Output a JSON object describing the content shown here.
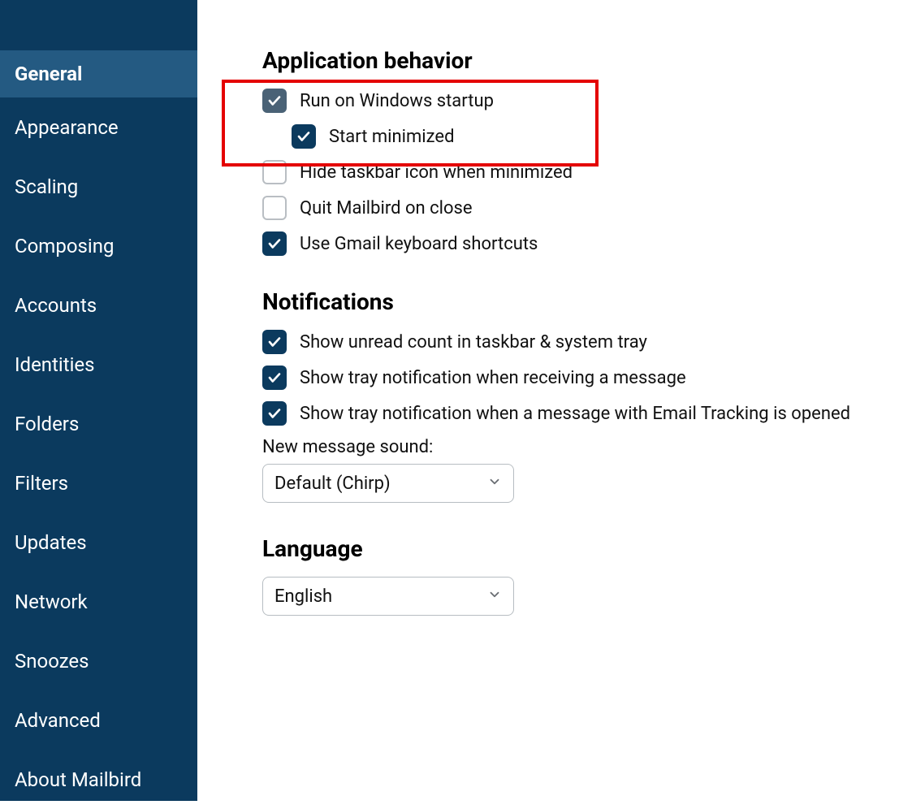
{
  "sidebar": {
    "items": [
      {
        "label": "General",
        "active": true
      },
      {
        "label": "Appearance",
        "active": false
      },
      {
        "label": "Scaling",
        "active": false
      },
      {
        "label": "Composing",
        "active": false
      },
      {
        "label": "Accounts",
        "active": false
      },
      {
        "label": "Identities",
        "active": false
      },
      {
        "label": "Folders",
        "active": false
      },
      {
        "label": "Filters",
        "active": false
      },
      {
        "label": "Updates",
        "active": false
      },
      {
        "label": "Network",
        "active": false
      },
      {
        "label": "Snoozes",
        "active": false
      },
      {
        "label": "Advanced",
        "active": false
      },
      {
        "label": "About Mailbird",
        "active": false
      }
    ]
  },
  "sections": {
    "app_behavior": {
      "title": "Application behavior",
      "options": {
        "run_on_startup": {
          "label": "Run on Windows startup",
          "checked": true,
          "style": "gray"
        },
        "start_minimized": {
          "label": "Start minimized",
          "checked": true,
          "style": "navy",
          "nested": true
        },
        "hide_taskbar": {
          "label": "Hide taskbar icon when minimized",
          "checked": false
        },
        "quit_on_close": {
          "label": "Quit Mailbird on close",
          "checked": false
        },
        "gmail_shortcuts": {
          "label": "Use Gmail keyboard shortcuts",
          "checked": true,
          "style": "navy"
        }
      }
    },
    "notifications": {
      "title": "Notifications",
      "options": {
        "unread_count": {
          "label": "Show unread count in taskbar & system tray",
          "checked": true,
          "style": "navy"
        },
        "tray_receive": {
          "label": "Show tray notification when receiving a message",
          "checked": true,
          "style": "navy"
        },
        "tray_tracking": {
          "label": "Show tray notification when a message with Email Tracking is opened",
          "checked": true,
          "style": "navy"
        }
      },
      "sound_label": "New message sound:",
      "sound_value": "Default (Chirp)"
    },
    "language": {
      "title": "Language",
      "value": "English"
    }
  }
}
